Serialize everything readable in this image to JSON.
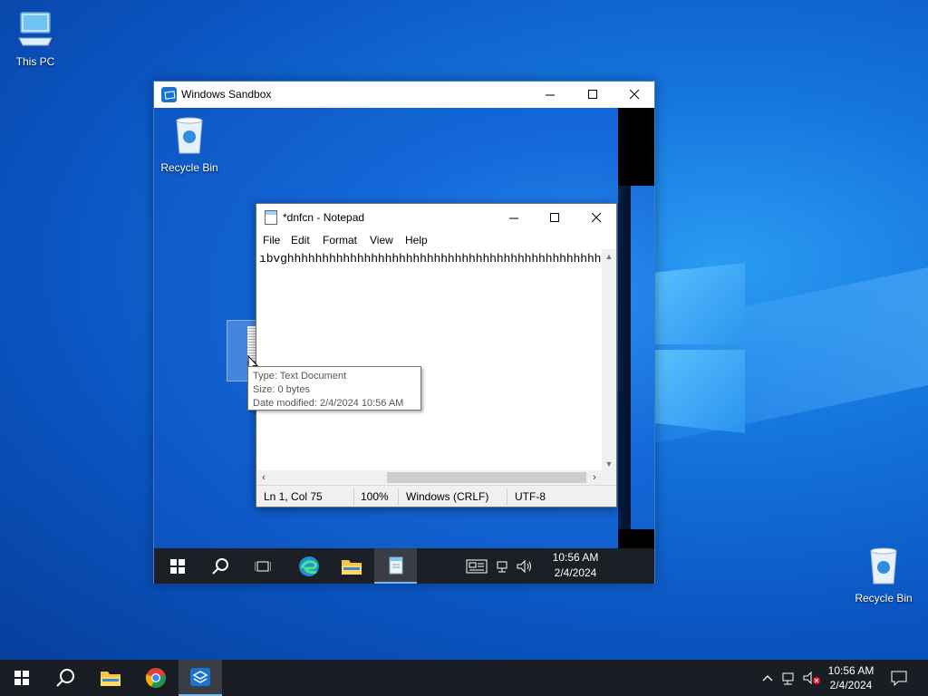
{
  "desktop": {
    "icons": [
      {
        "label": "This PC",
        "icon": "computer-icon"
      },
      {
        "label": "Recycle Bin",
        "icon": "recycle-bin-icon"
      }
    ]
  },
  "sandbox_window": {
    "title": "Windows Sandbox",
    "desktop_icons": [
      {
        "label": "Recycle Bin",
        "icon": "recycle-bin-icon"
      }
    ],
    "taskbar": {
      "time": "10:56 AM",
      "date": "2/4/2024",
      "apps": [
        "start-icon",
        "search-icon",
        "task-view-icon",
        "edge-icon",
        "file-explorer-icon",
        "notepad-icon"
      ]
    }
  },
  "notepad": {
    "title": "*dnfcn - Notepad",
    "menu": [
      "File",
      "Edit",
      "Format",
      "View",
      "Help"
    ],
    "content": "ıbvghhhhhhhhhhhhhhhhhhhhhhhhhhhhhhhhhhhhhhhhhhhhhhhh",
    "status": {
      "position": "Ln 1, Col 75",
      "zoom": "100%",
      "line_ending": "Windows (CRLF)",
      "encoding": "UTF-8"
    }
  },
  "tooltip": {
    "type": "Type: Text Document",
    "size": "Size: 0 bytes",
    "modified": "Date modified: 2/4/2024 10:56 AM"
  },
  "taskbar": {
    "apps": [
      "start-icon",
      "search-icon",
      "file-explorer-icon",
      "chrome-icon",
      "sandbox-icon"
    ],
    "time": "10:56 AM",
    "date": "2/4/2024"
  },
  "colors": {
    "accent": "#76b9ed",
    "taskbar": "#1a1d24",
    "wallpaper": "#0b55c2"
  }
}
